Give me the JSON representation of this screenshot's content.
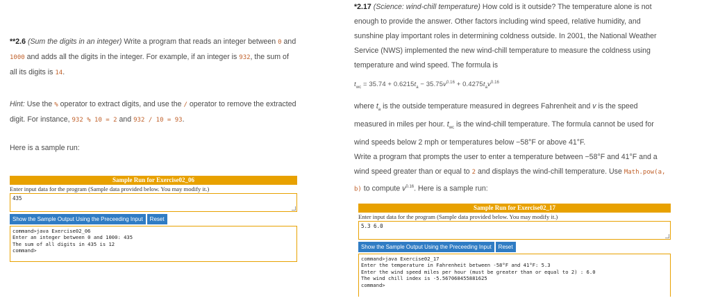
{
  "left": {
    "ex_num": "**2.6",
    "ex_title": "(Sum the digits in an integer)",
    "p1_a": "Write a program that reads an integer between",
    "p1_zero": "0",
    "p1_b": "and",
    "p1_1000": "1000",
    "p1_c": "and adds all the digits in the integer. For example, if an integer is",
    "p1_932": "932",
    "p1_d": ", the sum of all its digits is",
    "p1_14": "14",
    "p1_e": ".",
    "hint_label": "Hint:",
    "hint_a": "Use the",
    "hint_pct": "%",
    "hint_b": "operator to extract digits, and use the",
    "hint_slash": "/",
    "hint_c": "operator to remove the extracted digit. For instance,",
    "hint_expr1": "932 % 10 = 2",
    "hint_d": "and",
    "hint_expr2": "932 / 10 = 93",
    "hint_e": ".",
    "sample_text": "Here is a sample run:",
    "run": {
      "header": "Sample Run for Exercise02_06",
      "prompt": "Enter input data for the program (Sample data provided below. You may modify it.)",
      "input": "435",
      "btn_show": "Show the Sample Output Using the Preceeding Input",
      "btn_reset": "Reset",
      "out_lines": [
        "command>java Exercise02_06",
        "Enter an integer between 0 and 1000: 435",
        "The sum of all digits in 435 is 12",
        "",
        "command>"
      ]
    }
  },
  "right": {
    "ex_num": "*2.17",
    "ex_title": "(Science: wind-chill temperature)",
    "p1": "How cold is it outside? The temperature alone is not enough to provide the answer. Other factors including wind speed, relative humidity, and sunshine play important roles in determining coldness outside. In 2001, the National Weather Service (NWS) implemented the new wind-chill temperature to measure the coldness using temperature and wind speed. The formula is",
    "formula": {
      "lhs": "t",
      "lhs_sub": "wc",
      "eq": " = 35.74 + 0.6215",
      "t1": "t",
      "t1_sub": "a",
      "m1": " − 35.75",
      "v1": "v",
      "v1_sup": "0.16",
      "m2": " + 0.4275",
      "t2": "t",
      "t2_sub": "a",
      "v2": "v",
      "v2_sup": "0.16"
    },
    "p2_a": "where",
    "p2_ta": "t",
    "p2_ta_sub": "a",
    "p2_b": "is the outside temperature measured in degrees Fahrenheit and",
    "p2_v": "v",
    "p2_c": "is the speed measured in miles per hour.",
    "p2_twc": "t",
    "p2_twc_sub": "wc",
    "p2_d": "is the wind-chill temperature. The formula cannot be used for wind speeds below 2 mph or temperatures below −58°F or above 41°F.",
    "p3_a": "Write a program that prompts the user to enter a temperature between −58°F and 41°F and a wind speed greater than or equal to",
    "p3_2": "2",
    "p3_b": "and displays the wind-chill temperature. Use",
    "p3_code": "Math.pow(a, b)",
    "p3_c": "to compute",
    "p3_v": "v",
    "p3_v_sup": "0.16",
    "p3_d": ". Here is a sample run:",
    "run": {
      "header": "Sample Run for Exercise02_17",
      "prompt": "Enter input data for the program (Sample data provided below. You may modify it.)",
      "input": "5.3 6.0",
      "btn_show": "Show the Sample Output Using the Preceeding Input",
      "btn_reset": "Reset",
      "out_lines": [
        "command>java Exercise02_17",
        "Enter the temperature in Fahrenheit between -58°F and 41°F: 5.3",
        "Enter the wind speed miles per hour (must be greater than or equal to 2) : 6.0",
        "The wind chill index is -5.567068455881625",
        "",
        "command>"
      ]
    }
  },
  "colors": {
    "accent": "#e8a100",
    "button": "#2f7cc4",
    "code": "#c0602a"
  }
}
